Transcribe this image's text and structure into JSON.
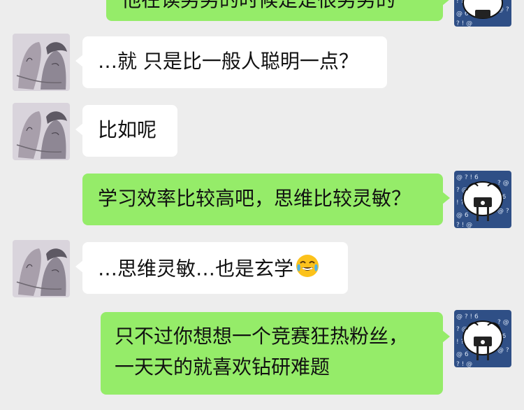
{
  "messages": [
    {
      "sender": "me",
      "text": "他在读男男的时候是是很男男的"
    },
    {
      "sender": "other",
      "text": "…就 只是比一般人聪明一点？"
    },
    {
      "sender": "other",
      "text": "比如呢"
    },
    {
      "sender": "me",
      "text": "学习效率比较高吧，思维比较灵敏？"
    },
    {
      "sender": "other",
      "text": "…思维灵敏…也是玄学",
      "emoji": "tears-of-joy-emoji"
    },
    {
      "sender": "me",
      "lines": [
        "只不过你想想一个竞赛狂热粉丝，",
        "一天天的就喜欢钻研难题"
      ]
    }
  ],
  "avatars": {
    "other": "anime-couple-avatar",
    "me": "cartoon-doodle-avatar"
  },
  "colors": {
    "background": "#ededed",
    "incoming_bubble": "#ffffff",
    "outgoing_bubble": "#95ec69"
  }
}
